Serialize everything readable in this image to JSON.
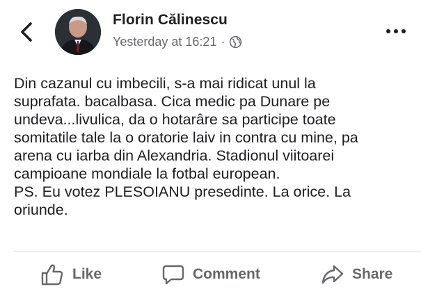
{
  "post": {
    "author": "Florin Călinescu",
    "timestamp": "Yesterday at 16:21",
    "separator": "·",
    "audience_icon": "globe-icon",
    "text": "Din cazanul cu imbecili, s-a mai ridicat unul la\nsuprafata. bacalbasa. Cica medic pa Dunare pe\nundeva...livulica, da o hotarâre sa participe toate\nsomitatile tale la o oratorie laiv in contra cu mine, pa\narena cu iarba din Alexandria. Stadionul viitoarei\ncampioane mondiale la fotbal european.\nPS. Eu votez PLESOIANU presedinte. La orice. La\noriunde."
  },
  "actions": {
    "like": "Like",
    "comment": "Comment",
    "share": "Share"
  },
  "colors": {
    "text": "#1c1e21",
    "secondary": "#65676b",
    "divider": "#dadde1"
  }
}
